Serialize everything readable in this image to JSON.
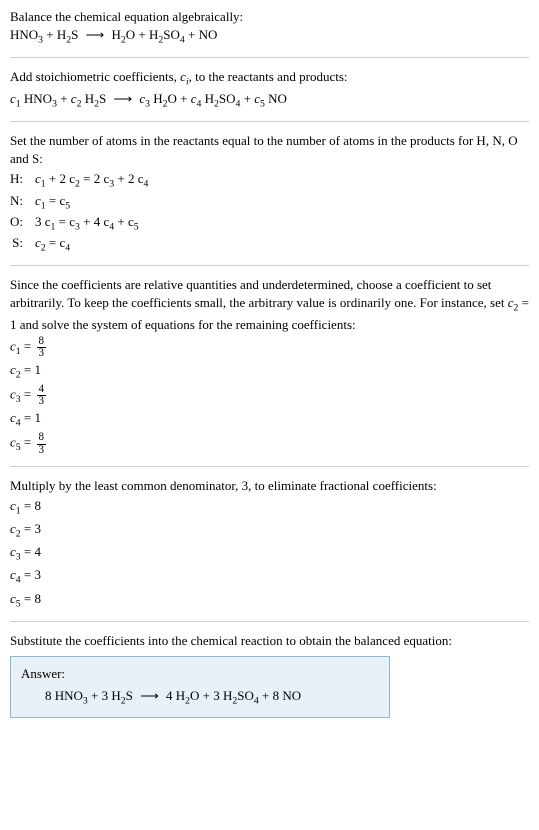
{
  "intro": {
    "line1": "Balance the chemical equation algebraically:",
    "eq_left1": "HNO",
    "eq_left1_sub": "3",
    "plus1": " + H",
    "eq_left2_sub": "2",
    "eq_left2": "S",
    "arrow": " ⟶ ",
    "eq_right1": "H",
    "eq_right1_sub": "2",
    "eq_right2": "O + H",
    "eq_right2_sub": "2",
    "eq_right3": "SO",
    "eq_right3_sub": "4",
    "eq_right4": " + NO"
  },
  "stoich": {
    "text1": "Add stoichiometric coefficients, ",
    "ci": "c",
    "ci_sub": "i",
    "text2": ", to the reactants and products:",
    "c1": "c",
    "c1_sub": "1",
    "hno3_h": " HNO",
    "hno3_sub": "3",
    "plus1": " + ",
    "c2": "c",
    "c2_sub": "2",
    "h2s_h": " H",
    "h2s_sub": "2",
    "h2s_s": "S",
    "arrow": " ⟶ ",
    "c3": "c",
    "c3_sub": "3",
    "h2o_h": " H",
    "h2o_sub": "2",
    "h2o_o": "O + ",
    "c4": "c",
    "c4_sub": "4",
    "h2so4_h": " H",
    "h2so4_sub1": "2",
    "h2so4_so": "SO",
    "h2so4_sub2": "4",
    "plus2": " + ",
    "c5": "c",
    "c5_sub": "5",
    "no": " NO"
  },
  "atoms": {
    "text": "Set the number of atoms in the reactants equal to the number of atoms in the products for H, N, O and S:",
    "rows": [
      {
        "el": "H:",
        "lhs_a": "c",
        "lhs_a_sub": "1",
        "lhs_b": " + 2 c",
        "lhs_b_sub": "2",
        "eq": " = 2 c",
        "rhs_a_sub": "3",
        "rhs_b": " + 2 c",
        "rhs_b_sub": "4"
      },
      {
        "el": "N:",
        "lhs_a": "c",
        "lhs_a_sub": "1",
        "eq": " = c",
        "rhs_a_sub": "5"
      },
      {
        "el": "O:",
        "lhs_a": "3 c",
        "lhs_a_sub": "1",
        "eq": " = c",
        "rhs_a_sub": "3",
        "rhs_b": " + 4 c",
        "rhs_b_sub": "4",
        "rhs_c": " + c",
        "rhs_c_sub": "5"
      },
      {
        "el": "S:",
        "lhs_a": "c",
        "lhs_a_sub": "2",
        "eq": " = c",
        "rhs_a_sub": "4"
      }
    ]
  },
  "choose": {
    "text1": "Since the coefficients are relative quantities and underdetermined, choose a coefficient to set arbitrarily. To keep the coefficients small, the arbitrary value is ordinarily one. For instance, set ",
    "c2": "c",
    "c2_sub": "2",
    "text2": " = 1 and solve the system of equations for the remaining coefficients:",
    "coefs": [
      {
        "c": "c",
        "sub": "1",
        "eq": " = ",
        "num": "8",
        "den": "3"
      },
      {
        "c": "c",
        "sub": "2",
        "eq": " = 1"
      },
      {
        "c": "c",
        "sub": "3",
        "eq": " = ",
        "num": "4",
        "den": "3"
      },
      {
        "c": "c",
        "sub": "4",
        "eq": " = 1"
      },
      {
        "c": "c",
        "sub": "5",
        "eq": " = ",
        "num": "8",
        "den": "3"
      }
    ]
  },
  "multiply": {
    "text": "Multiply by the least common denominator, 3, to eliminate fractional coefficients:",
    "coefs": [
      {
        "c": "c",
        "sub": "1",
        "val": " = 8"
      },
      {
        "c": "c",
        "sub": "2",
        "val": " = 3"
      },
      {
        "c": "c",
        "sub": "3",
        "val": " = 4"
      },
      {
        "c": "c",
        "sub": "4",
        "val": " = 3"
      },
      {
        "c": "c",
        "sub": "5",
        "val": " = 8"
      }
    ]
  },
  "final": {
    "text": "Substitute the coefficients into the chemical reaction to obtain the balanced equation:",
    "label": "Answer:",
    "eq_1": "8 HNO",
    "eq_1_sub": "3",
    "eq_2": " + 3 H",
    "eq_2_sub": "2",
    "eq_3": "S",
    "arrow": " ⟶ ",
    "eq_4": "4 H",
    "eq_4_sub": "2",
    "eq_5": "O + 3 H",
    "eq_5_sub": "2",
    "eq_6": "SO",
    "eq_6_sub": "4",
    "eq_7": " + 8 NO"
  }
}
